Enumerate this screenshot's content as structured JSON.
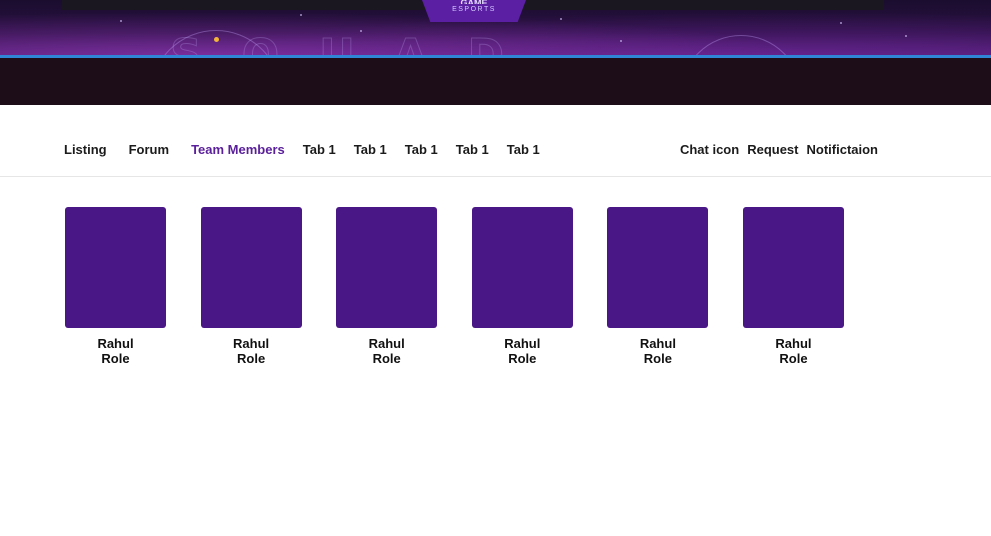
{
  "banner": {
    "logo_brand": "GAME",
    "logo_sub": "ESPORTS",
    "colors": {
      "accent_line": "#2f86d6",
      "dark_bar": "#1c0d18",
      "logo": "#5a1fa3"
    }
  },
  "nav": {
    "tabs": [
      {
        "label": "Listing",
        "active": false
      },
      {
        "label": "Forum",
        "active": false
      },
      {
        "label": "Team Members",
        "active": true
      },
      {
        "label": "Tab 1",
        "active": false
      },
      {
        "label": "Tab 1",
        "active": false
      },
      {
        "label": "Tab 1",
        "active": false
      },
      {
        "label": "Tab 1",
        "active": false
      },
      {
        "label": "Tab 1",
        "active": false
      }
    ],
    "right": {
      "chat": "Chat icon",
      "request": "Request",
      "notification": "Notifictaion"
    },
    "active_color": "#5a1f9a"
  },
  "members": [
    {
      "name": "Rahul",
      "role": "Role"
    },
    {
      "name": "Rahul",
      "role": "Role"
    },
    {
      "name": "Rahul",
      "role": "Role"
    },
    {
      "name": "Rahul",
      "role": "Role"
    },
    {
      "name": "Rahul",
      "role": "Role"
    },
    {
      "name": "Rahul",
      "role": "Role"
    }
  ],
  "avatar_color": "#4a1786"
}
